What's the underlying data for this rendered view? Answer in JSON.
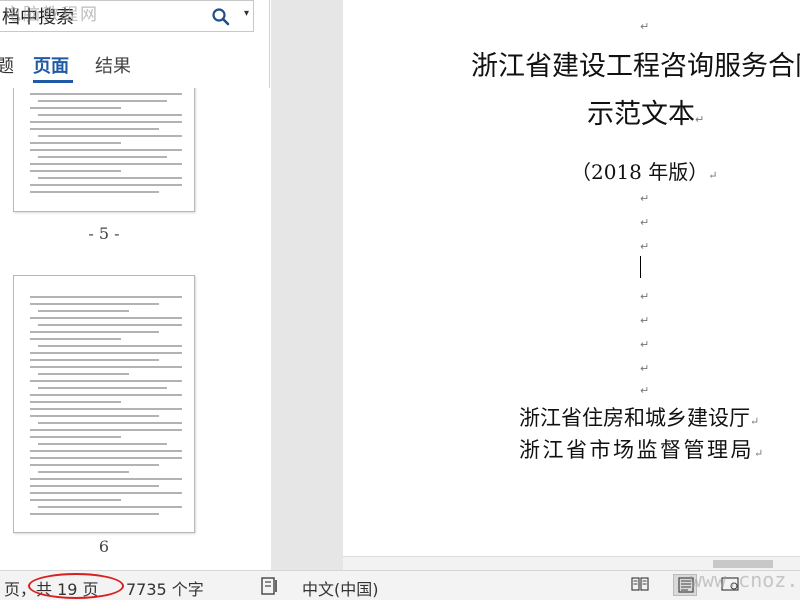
{
  "nav": {
    "search_placeholder": "档中搜索",
    "tab_edge": "题",
    "tabs": {
      "pages": "页面",
      "results": "结果"
    },
    "page_labels": {
      "p5": "- 5 -",
      "p6": "6"
    }
  },
  "document": {
    "title_line1": "浙江省建设工程咨询服务合同",
    "title_line2": "示范文本",
    "edition": "（2018 年版）",
    "issuer_line1": "浙江省住房和城乡建设厅",
    "issuer_line2": "浙江省市场监督管理局",
    "paragraph_mark": "↵"
  },
  "status": {
    "page_prefix": "页，",
    "page_count": "共 19 页",
    "word_count": "7735 个字",
    "language": "中文(中国)"
  },
  "watermarks": {
    "top_left": "电脑教程网",
    "bottom_right": "www.cnoz.com"
  },
  "colors": {
    "accent": "#1f5aa6",
    "highlight_circle": "#d81e1e",
    "status_bg": "#f3f3f3",
    "gap_bg": "#e6e6e6"
  },
  "icons": [
    "search-icon",
    "dropdown-arrow-icon",
    "proofing-icon",
    "read-mode-icon",
    "print-layout-icon",
    "web-layout-icon"
  ]
}
